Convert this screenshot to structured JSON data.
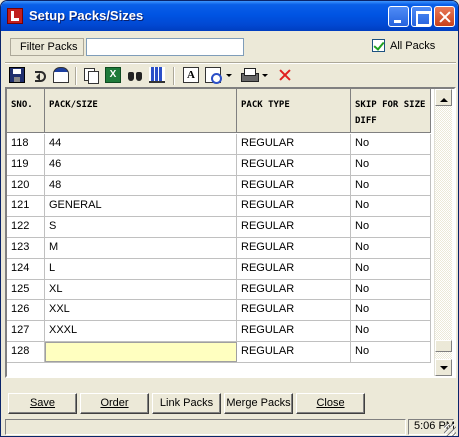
{
  "window": {
    "title": "Setup Packs/Sizes"
  },
  "filter": {
    "label": "Filter Packs",
    "value": "",
    "all_packs_label": "All Packs",
    "all_packs_checked": true
  },
  "toolbar": {
    "icons": [
      "save-icon",
      "undo-icon",
      "window-icon",
      "copy-icon",
      "excel-icon",
      "find-icon",
      "chart-icon",
      "text-icon",
      "print-preview-icon",
      "print-icon",
      "delete-icon"
    ],
    "text_icon_glyph": "A",
    "excel_glyph": "X"
  },
  "grid": {
    "columns": [
      {
        "label": "SNO."
      },
      {
        "label": "PACK/SIZE"
      },
      {
        "label": "PACK TYPE"
      },
      {
        "label": "SKIP FOR SIZE DIFF"
      }
    ],
    "rows": [
      {
        "sno": "118",
        "pack": "44",
        "type": "REGULAR",
        "skip": "No"
      },
      {
        "sno": "119",
        "pack": "46",
        "type": "REGULAR",
        "skip": "No"
      },
      {
        "sno": "120",
        "pack": "48",
        "type": "REGULAR",
        "skip": "No"
      },
      {
        "sno": "121",
        "pack": "GENERAL",
        "type": "REGULAR",
        "skip": "No"
      },
      {
        "sno": "122",
        "pack": "S",
        "type": "REGULAR",
        "skip": "No"
      },
      {
        "sno": "123",
        "pack": "M",
        "type": "REGULAR",
        "skip": "No"
      },
      {
        "sno": "124",
        "pack": "L",
        "type": "REGULAR",
        "skip": "No"
      },
      {
        "sno": "125",
        "pack": "XL",
        "type": "REGULAR",
        "skip": "No"
      },
      {
        "sno": "126",
        "pack": "XXL",
        "type": "REGULAR",
        "skip": "No"
      },
      {
        "sno": "127",
        "pack": "XXXL",
        "type": "REGULAR",
        "skip": "No"
      },
      {
        "sno": "128",
        "pack": "",
        "type": "REGULAR",
        "skip": "No"
      }
    ],
    "scroll_position": 0.97
  },
  "buttons": {
    "save": "Save",
    "order": "Order",
    "link_packs": "Link Packs",
    "merge_packs": "Merge Packs",
    "close": "Close"
  },
  "status": {
    "time": "5:06 PM"
  }
}
